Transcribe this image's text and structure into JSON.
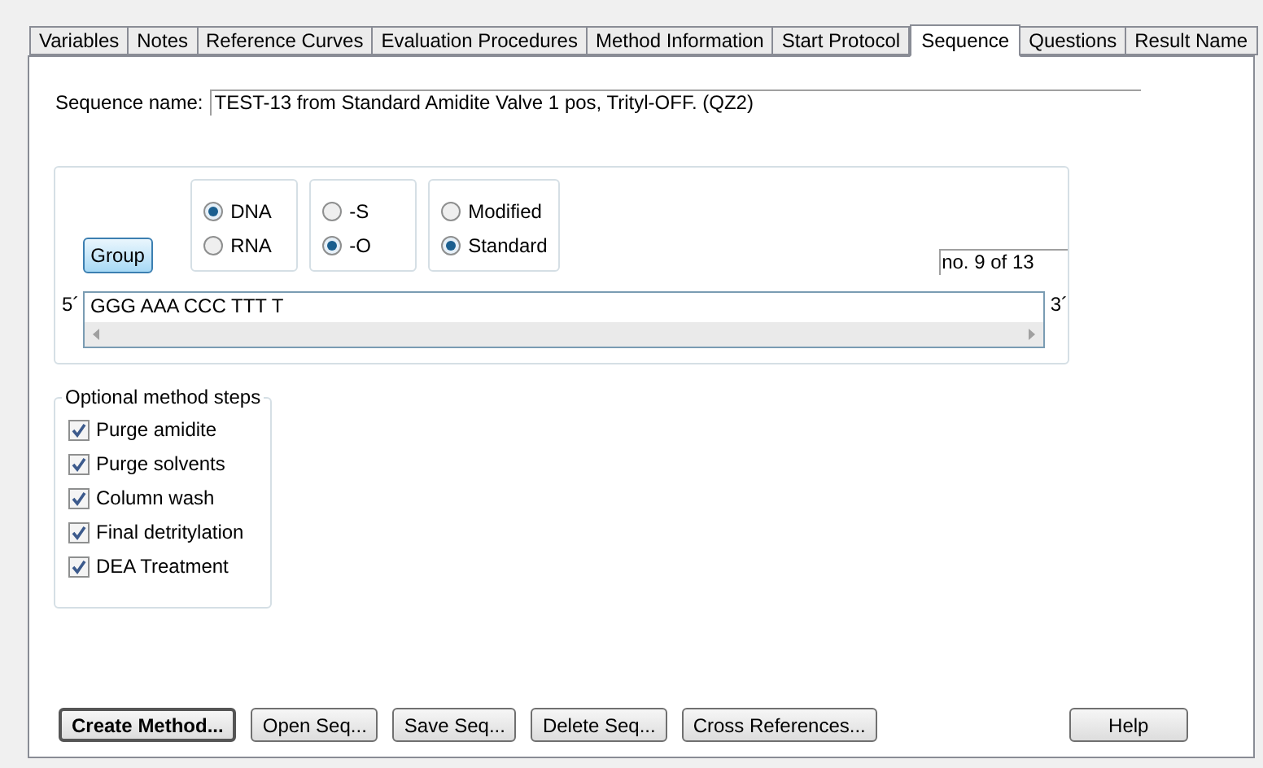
{
  "tabs": [
    {
      "label": "Variables",
      "selected": false
    },
    {
      "label": "Notes",
      "selected": false
    },
    {
      "label": "Reference Curves",
      "selected": false
    },
    {
      "label": "Evaluation Procedures",
      "selected": false
    },
    {
      "label": "Method Information",
      "selected": false
    },
    {
      "label": "Start Protocol",
      "selected": false
    },
    {
      "label": "Sequence",
      "selected": true
    },
    {
      "label": "Questions",
      "selected": false
    },
    {
      "label": "Result Name",
      "selected": false
    }
  ],
  "sequence_name": {
    "label": "Sequence name:",
    "value": "TEST-13 from Standard Amidite Valve 1 pos, Trityl-OFF. (QZ2)"
  },
  "group_button": "Group",
  "radio_groups": [
    {
      "options": [
        {
          "label": "DNA",
          "selected": true
        },
        {
          "label": "RNA",
          "selected": false
        }
      ]
    },
    {
      "options": [
        {
          "label": "-S",
          "selected": false
        },
        {
          "label": "-O",
          "selected": true
        }
      ]
    },
    {
      "options": [
        {
          "label": "Modified",
          "selected": false
        },
        {
          "label": "Standard",
          "selected": true
        }
      ]
    }
  ],
  "sequence_number": "no. 9 of 13",
  "sequence": {
    "five_prime": "5´",
    "value": "GGG AAA CCC TTT T",
    "three_prime": "3´"
  },
  "optional_steps": {
    "title": "Optional method steps",
    "items": [
      {
        "label": "Purge amidite",
        "checked": true
      },
      {
        "label": "Purge solvents",
        "checked": true
      },
      {
        "label": "Column wash",
        "checked": true
      },
      {
        "label": "Final detritylation",
        "checked": true
      },
      {
        "label": "DEA Treatment",
        "checked": true
      }
    ]
  },
  "buttons": [
    {
      "label": "Create Method...",
      "default": true
    },
    {
      "label": "Open Seq...",
      "default": false
    },
    {
      "label": "Save Seq...",
      "default": false
    },
    {
      "label": "Delete Seq...",
      "default": false
    },
    {
      "label": "Cross References...",
      "default": false
    }
  ],
  "help_button": "Help"
}
